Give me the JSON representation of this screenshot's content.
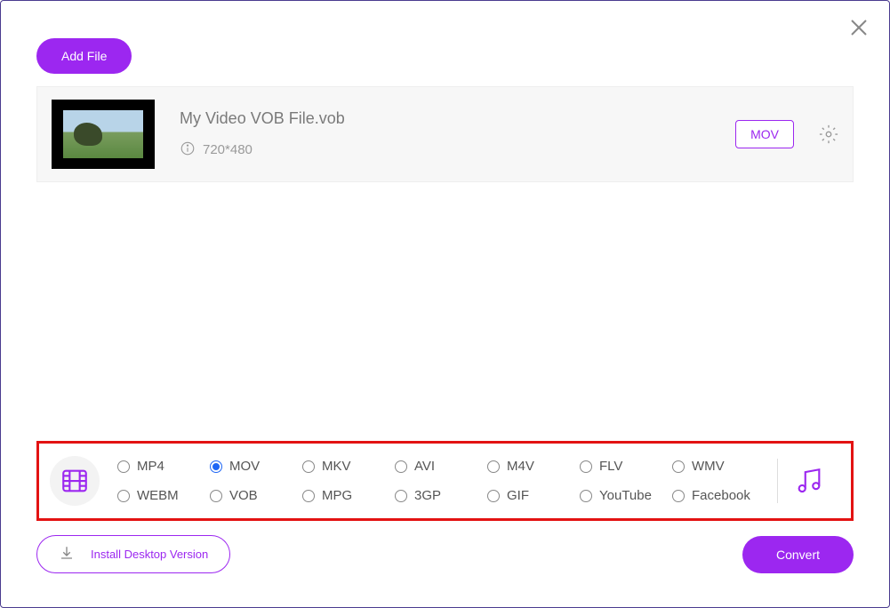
{
  "header": {
    "add_file_label": "Add File"
  },
  "file": {
    "name": "My Video VOB File.vob",
    "resolution": "720*480",
    "format_badge": "MOV"
  },
  "formats": {
    "selected": "MOV",
    "row1": [
      "MP4",
      "MOV",
      "MKV",
      "AVI",
      "M4V",
      "FLV",
      "WMV"
    ],
    "row2": [
      "WEBM",
      "VOB",
      "MPG",
      "3GP",
      "GIF",
      "YouTube",
      "Facebook"
    ]
  },
  "footer": {
    "install_label": "Install Desktop Version",
    "convert_label": "Convert"
  }
}
